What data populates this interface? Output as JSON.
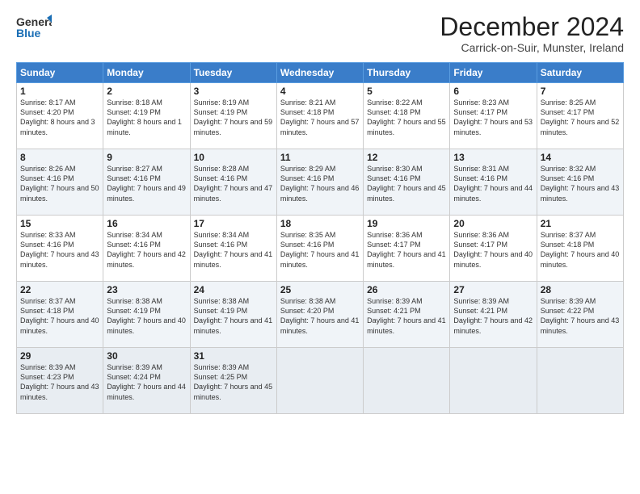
{
  "header": {
    "logo": {
      "general": "General",
      "blue": "Blue"
    },
    "title": "December 2024",
    "subtitle": "Carrick-on-Suir, Munster, Ireland"
  },
  "calendar": {
    "days": [
      "Sunday",
      "Monday",
      "Tuesday",
      "Wednesday",
      "Thursday",
      "Friday",
      "Saturday"
    ],
    "weeks": [
      [
        {
          "day": "1",
          "sunrise": "Sunrise: 8:17 AM",
          "sunset": "Sunset: 4:20 PM",
          "daylight": "Daylight: 8 hours and 3 minutes."
        },
        {
          "day": "2",
          "sunrise": "Sunrise: 8:18 AM",
          "sunset": "Sunset: 4:19 PM",
          "daylight": "Daylight: 8 hours and 1 minute."
        },
        {
          "day": "3",
          "sunrise": "Sunrise: 8:19 AM",
          "sunset": "Sunset: 4:19 PM",
          "daylight": "Daylight: 7 hours and 59 minutes."
        },
        {
          "day": "4",
          "sunrise": "Sunrise: 8:21 AM",
          "sunset": "Sunset: 4:18 PM",
          "daylight": "Daylight: 7 hours and 57 minutes."
        },
        {
          "day": "5",
          "sunrise": "Sunrise: 8:22 AM",
          "sunset": "Sunset: 4:18 PM",
          "daylight": "Daylight: 7 hours and 55 minutes."
        },
        {
          "day": "6",
          "sunrise": "Sunrise: 8:23 AM",
          "sunset": "Sunset: 4:17 PM",
          "daylight": "Daylight: 7 hours and 53 minutes."
        },
        {
          "day": "7",
          "sunrise": "Sunrise: 8:25 AM",
          "sunset": "Sunset: 4:17 PM",
          "daylight": "Daylight: 7 hours and 52 minutes."
        }
      ],
      [
        {
          "day": "8",
          "sunrise": "Sunrise: 8:26 AM",
          "sunset": "Sunset: 4:16 PM",
          "daylight": "Daylight: 7 hours and 50 minutes."
        },
        {
          "day": "9",
          "sunrise": "Sunrise: 8:27 AM",
          "sunset": "Sunset: 4:16 PM",
          "daylight": "Daylight: 7 hours and 49 minutes."
        },
        {
          "day": "10",
          "sunrise": "Sunrise: 8:28 AM",
          "sunset": "Sunset: 4:16 PM",
          "daylight": "Daylight: 7 hours and 47 minutes."
        },
        {
          "day": "11",
          "sunrise": "Sunrise: 8:29 AM",
          "sunset": "Sunset: 4:16 PM",
          "daylight": "Daylight: 7 hours and 46 minutes."
        },
        {
          "day": "12",
          "sunrise": "Sunrise: 8:30 AM",
          "sunset": "Sunset: 4:16 PM",
          "daylight": "Daylight: 7 hours and 45 minutes."
        },
        {
          "day": "13",
          "sunrise": "Sunrise: 8:31 AM",
          "sunset": "Sunset: 4:16 PM",
          "daylight": "Daylight: 7 hours and 44 minutes."
        },
        {
          "day": "14",
          "sunrise": "Sunrise: 8:32 AM",
          "sunset": "Sunset: 4:16 PM",
          "daylight": "Daylight: 7 hours and 43 minutes."
        }
      ],
      [
        {
          "day": "15",
          "sunrise": "Sunrise: 8:33 AM",
          "sunset": "Sunset: 4:16 PM",
          "daylight": "Daylight: 7 hours and 43 minutes."
        },
        {
          "day": "16",
          "sunrise": "Sunrise: 8:34 AM",
          "sunset": "Sunset: 4:16 PM",
          "daylight": "Daylight: 7 hours and 42 minutes."
        },
        {
          "day": "17",
          "sunrise": "Sunrise: 8:34 AM",
          "sunset": "Sunset: 4:16 PM",
          "daylight": "Daylight: 7 hours and 41 minutes."
        },
        {
          "day": "18",
          "sunrise": "Sunrise: 8:35 AM",
          "sunset": "Sunset: 4:16 PM",
          "daylight": "Daylight: 7 hours and 41 minutes."
        },
        {
          "day": "19",
          "sunrise": "Sunrise: 8:36 AM",
          "sunset": "Sunset: 4:17 PM",
          "daylight": "Daylight: 7 hours and 41 minutes."
        },
        {
          "day": "20",
          "sunrise": "Sunrise: 8:36 AM",
          "sunset": "Sunset: 4:17 PM",
          "daylight": "Daylight: 7 hours and 40 minutes."
        },
        {
          "day": "21",
          "sunrise": "Sunrise: 8:37 AM",
          "sunset": "Sunset: 4:18 PM",
          "daylight": "Daylight: 7 hours and 40 minutes."
        }
      ],
      [
        {
          "day": "22",
          "sunrise": "Sunrise: 8:37 AM",
          "sunset": "Sunset: 4:18 PM",
          "daylight": "Daylight: 7 hours and 40 minutes."
        },
        {
          "day": "23",
          "sunrise": "Sunrise: 8:38 AM",
          "sunset": "Sunset: 4:19 PM",
          "daylight": "Daylight: 7 hours and 40 minutes."
        },
        {
          "day": "24",
          "sunrise": "Sunrise: 8:38 AM",
          "sunset": "Sunset: 4:19 PM",
          "daylight": "Daylight: 7 hours and 41 minutes."
        },
        {
          "day": "25",
          "sunrise": "Sunrise: 8:38 AM",
          "sunset": "Sunset: 4:20 PM",
          "daylight": "Daylight: 7 hours and 41 minutes."
        },
        {
          "day": "26",
          "sunrise": "Sunrise: 8:39 AM",
          "sunset": "Sunset: 4:21 PM",
          "daylight": "Daylight: 7 hours and 41 minutes."
        },
        {
          "day": "27",
          "sunrise": "Sunrise: 8:39 AM",
          "sunset": "Sunset: 4:21 PM",
          "daylight": "Daylight: 7 hours and 42 minutes."
        },
        {
          "day": "28",
          "sunrise": "Sunrise: 8:39 AM",
          "sunset": "Sunset: 4:22 PM",
          "daylight": "Daylight: 7 hours and 43 minutes."
        }
      ],
      [
        {
          "day": "29",
          "sunrise": "Sunrise: 8:39 AM",
          "sunset": "Sunset: 4:23 PM",
          "daylight": "Daylight: 7 hours and 43 minutes."
        },
        {
          "day": "30",
          "sunrise": "Sunrise: 8:39 AM",
          "sunset": "Sunset: 4:24 PM",
          "daylight": "Daylight: 7 hours and 44 minutes."
        },
        {
          "day": "31",
          "sunrise": "Sunrise: 8:39 AM",
          "sunset": "Sunset: 4:25 PM",
          "daylight": "Daylight: 7 hours and 45 minutes."
        },
        null,
        null,
        null,
        null
      ]
    ]
  }
}
